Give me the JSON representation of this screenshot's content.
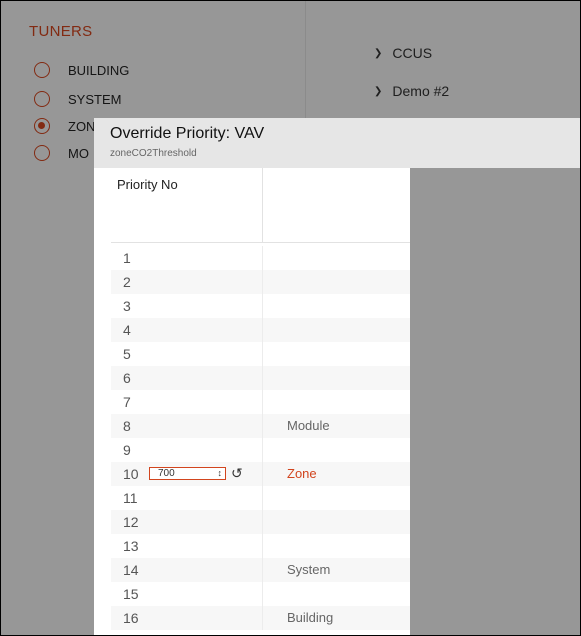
{
  "tuners": {
    "title": "TUNERS",
    "options": [
      {
        "label": "BUILDING",
        "checked": false
      },
      {
        "label": "SYSTEM",
        "checked": false
      },
      {
        "label": "ZON",
        "checked": true
      },
      {
        "label": "MO",
        "checked": false
      }
    ]
  },
  "tree": {
    "items": [
      {
        "icon": "chevron-down-icon",
        "label": "CCUS"
      },
      {
        "icon": "chevron-down-icon",
        "label": "Demo #2"
      }
    ]
  },
  "modal": {
    "title": "Override Priority: VAV",
    "subtitle": "zoneCO2Threshold",
    "column_header": "Priority No",
    "rows": [
      {
        "num": "1",
        "level": ""
      },
      {
        "num": "2",
        "level": ""
      },
      {
        "num": "3",
        "level": ""
      },
      {
        "num": "4",
        "level": ""
      },
      {
        "num": "5",
        "level": ""
      },
      {
        "num": "6",
        "level": ""
      },
      {
        "num": "7",
        "level": ""
      },
      {
        "num": "8",
        "level": "Module"
      },
      {
        "num": "9",
        "level": ""
      },
      {
        "num": "10",
        "level": "Zone",
        "value": "700",
        "active": true
      },
      {
        "num": "11",
        "level": ""
      },
      {
        "num": "12",
        "level": ""
      },
      {
        "num": "13",
        "level": ""
      },
      {
        "num": "14",
        "level": "System"
      },
      {
        "num": "15",
        "level": ""
      },
      {
        "num": "16",
        "level": "Building"
      }
    ]
  },
  "colors": {
    "accent": "#d2451e",
    "overlay": "rgba(0,0,0,0.38)",
    "header_bg": "#e6e6e6"
  }
}
